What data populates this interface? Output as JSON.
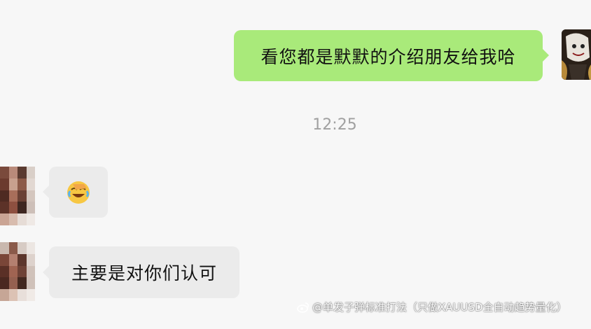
{
  "chat": {
    "messages": [
      {
        "sender": "me",
        "text": "看您都是默默的介绍朋友给我哈"
      },
      {
        "timestamp": "12:25"
      },
      {
        "sender": "other",
        "emoji": "facepalm-laugh-emoji"
      },
      {
        "sender": "other",
        "text": "主要是对你们认可"
      }
    ]
  },
  "watermark": {
    "text": "@单发子弹标准打法（只做XAUUSD全自动趋势量化）",
    "icon": "weibo-icon"
  }
}
